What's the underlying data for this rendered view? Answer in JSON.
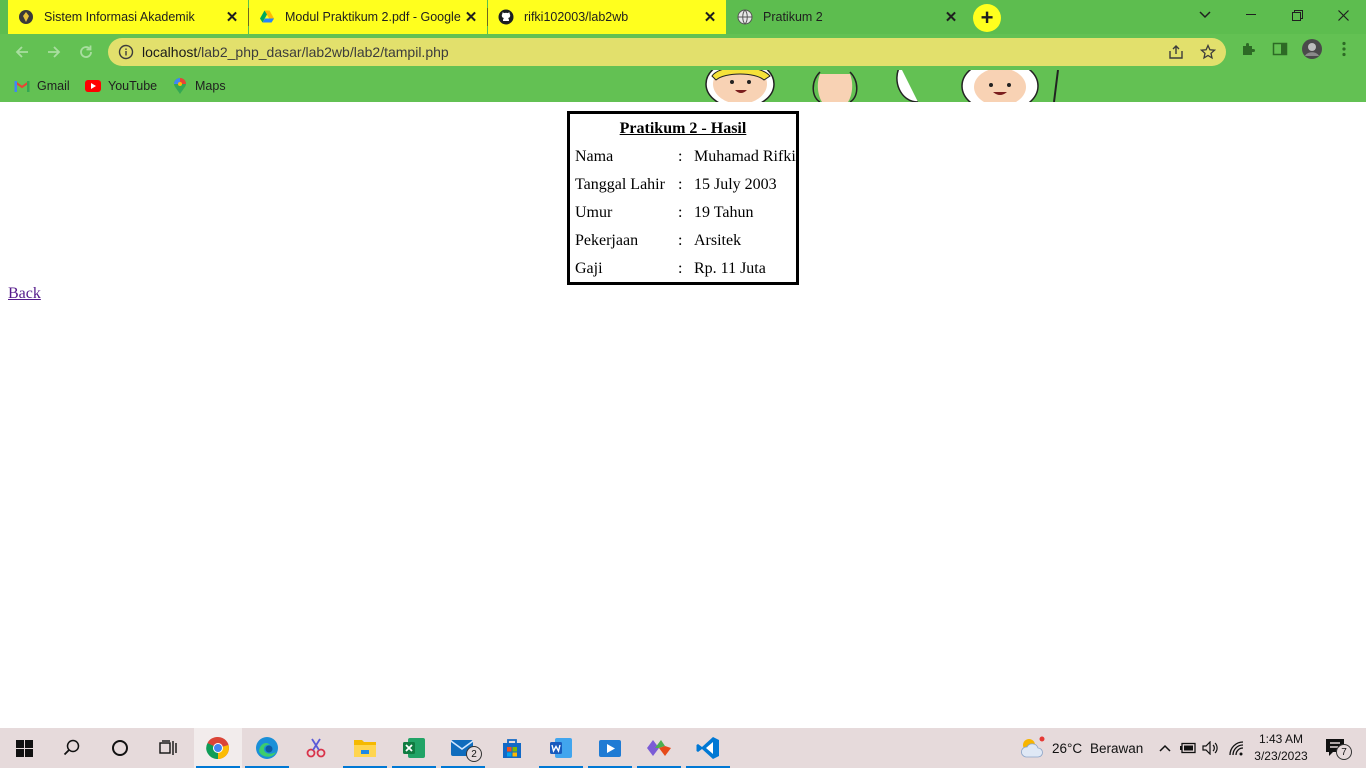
{
  "browser": {
    "tabs": [
      {
        "title": "Sistem Informasi Akademik",
        "icon": "university-logo-icon",
        "active": false
      },
      {
        "title": "Modul Praktikum 2.pdf - Google",
        "icon": "google-drive-icon",
        "active": false
      },
      {
        "title": "rifki102003/lab2wb",
        "icon": "github-icon",
        "active": false
      },
      {
        "title": "Pratikum 2",
        "icon": "globe-icon",
        "active": true
      }
    ],
    "address": {
      "host": "localhost",
      "path": "/lab2_php_dasar/lab2wb/lab2/tampil.php"
    },
    "bookmarks": [
      {
        "label": "Gmail",
        "icon": "gmail-icon"
      },
      {
        "label": "YouTube",
        "icon": "youtube-icon"
      },
      {
        "label": "Maps",
        "icon": "maps-icon"
      }
    ],
    "theme_color": "#5dbd4f",
    "inactive_tab_color": "#ffff1e"
  },
  "page": {
    "table_title": "Pratikum 2 - Hasil",
    "separator": ":",
    "rows": [
      {
        "label": "Nama",
        "value": "Muhamad Rifki"
      },
      {
        "label": "Tanggal Lahir",
        "value": "15 July 2003"
      },
      {
        "label": "Umur",
        "value": "19 Tahun"
      },
      {
        "label": "Pekerjaan",
        "value": "Arsitek"
      },
      {
        "label": "Gaji",
        "value": "Rp. 11 Juta"
      }
    ],
    "back_link": "Back"
  },
  "taskbar": {
    "pinned": [
      "windows-start-icon",
      "search-icon",
      "cortana-icon",
      "task-view-icon",
      "chrome-icon",
      "edge-icon",
      "snipping-tool-icon",
      "file-explorer-icon",
      "excel-icon",
      "mail-icon",
      "store-icon",
      "word-icon",
      "media-player-icon",
      "git-icon",
      "vscode-icon"
    ],
    "mail_badge": "2",
    "weather": {
      "temp": "26°C",
      "condition": "Berawan"
    },
    "time": "1:43 AM",
    "date": "3/23/2023",
    "notifications": "7"
  }
}
